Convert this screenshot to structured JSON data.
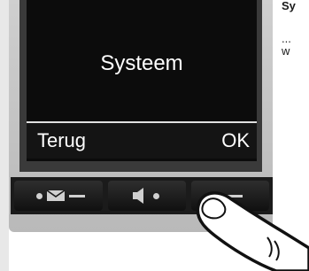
{
  "screen": {
    "title": "Systeem",
    "left_softkey": "Terug",
    "right_softkey": "OK"
  },
  "side_text": {
    "heading": "Sy",
    "ellipsis": "...",
    "line": "w"
  },
  "keys": [
    {
      "icon": "message-icon"
    },
    {
      "icon": "speaker-icon"
    },
    {
      "icon": "end-call-icon"
    }
  ]
}
